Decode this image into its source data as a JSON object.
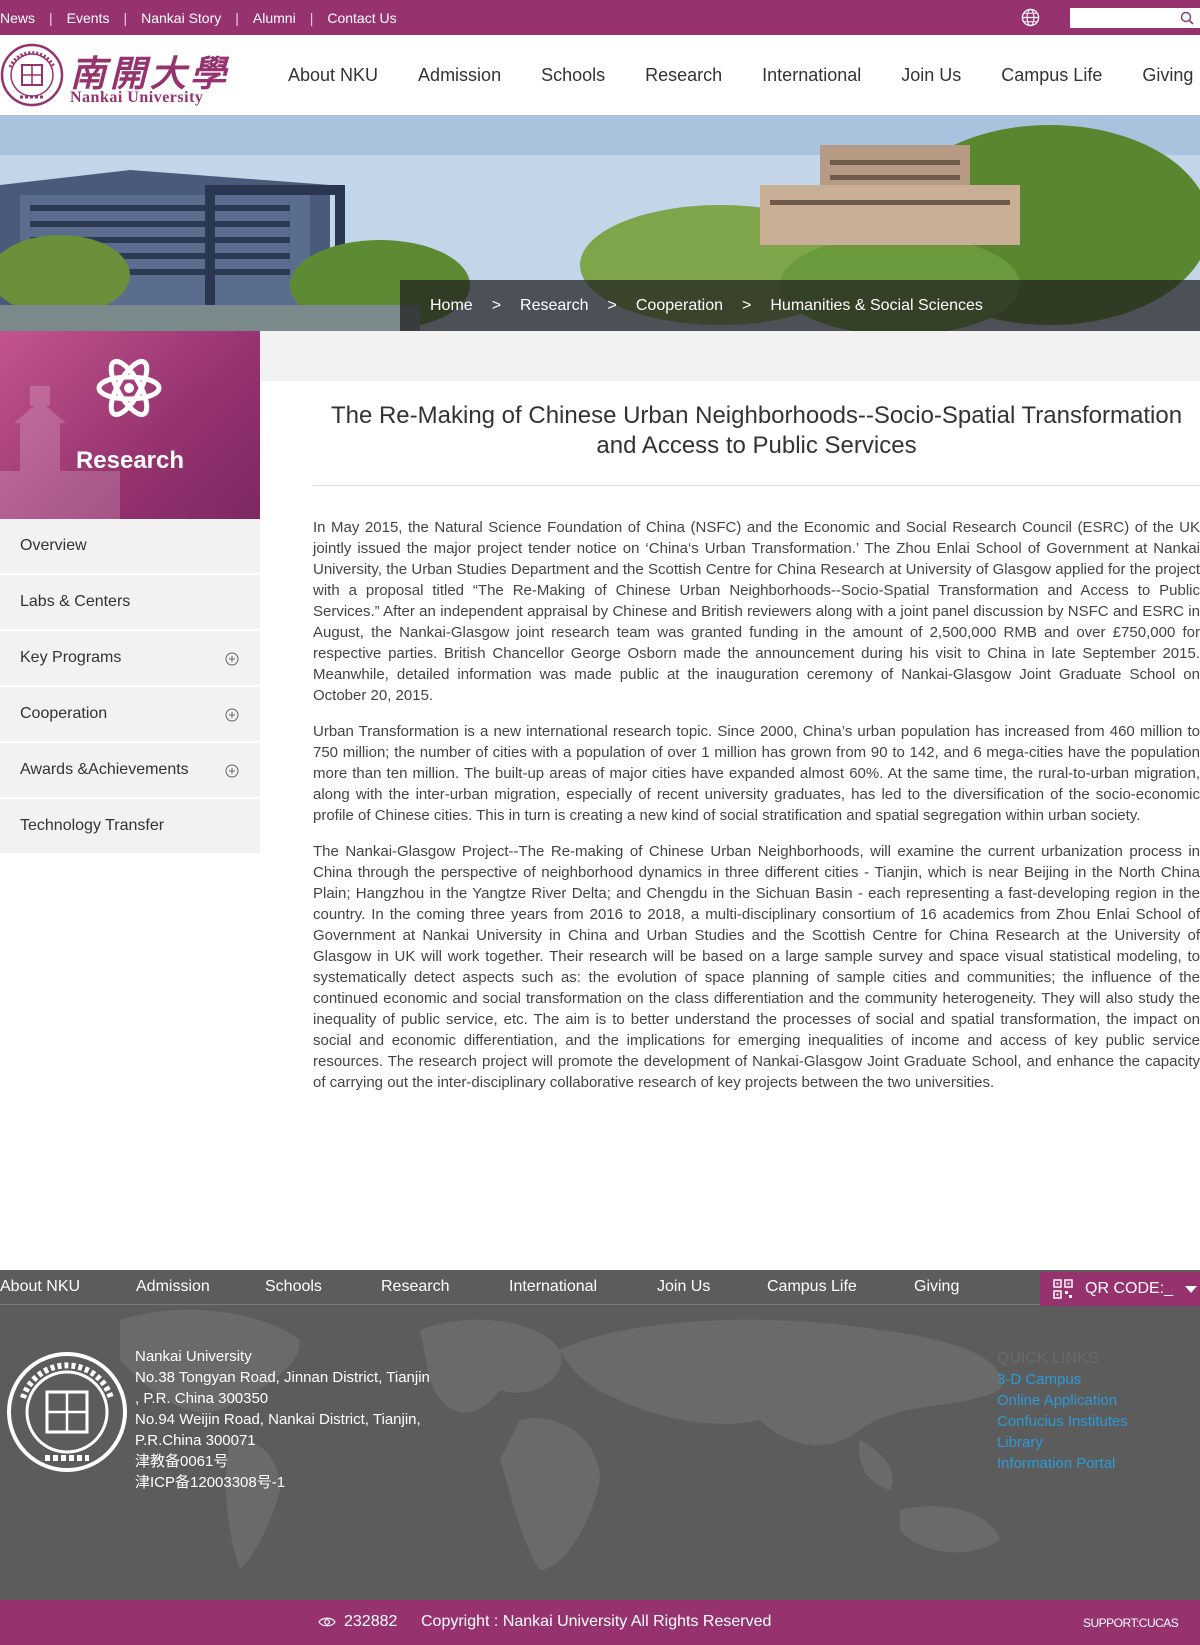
{
  "topbar": {
    "links": [
      "News",
      "Events",
      "Nankai Story",
      "Alumni",
      "Contact Us"
    ],
    "search_placeholder": ""
  },
  "header": {
    "logo_cn": "南開大學",
    "logo_en": "Nankai University",
    "nav": [
      "About NKU",
      "Admission",
      "Schools",
      "Research",
      "International",
      "Join Us",
      "Campus Life",
      "Giving"
    ]
  },
  "breadcrumb": {
    "items": [
      "Home",
      "Research",
      "Cooperation",
      "Humanities & Social Sciences"
    ],
    "separator": ">"
  },
  "sidebar": {
    "title": "Research",
    "items": [
      {
        "label": "Overview",
        "expandable": false
      },
      {
        "label": "Labs & Centers",
        "expandable": false
      },
      {
        "label": "Key Programs",
        "expandable": true
      },
      {
        "label": "Cooperation",
        "expandable": true
      },
      {
        "label": "Awards &Achievements",
        "expandable": true
      },
      {
        "label": "Technology Transfer",
        "expandable": false
      }
    ]
  },
  "article": {
    "title": "The Re-Making of Chinese Urban Neighborhoods--Socio-Spatial Transformation and Access to Public Services",
    "paragraphs": [
      "In May 2015, the Natural Science Foundation of China (NSFC) and the Economic and Social Research Council (ESRC) of the UK jointly issued the major project tender notice on ‘China‘s Urban Transformation.’ The Zhou Enlai School of Government at Nankai University, the Urban Studies Department and the Scottish Centre for China Research at University of Glasgow applied for the project with a proposal titled “The Re-Making of Chinese Urban Neighborhoods--Socio-Spatial Transformation and Access to Public Services.” After an independent appraisal by Chinese and British reviewers along with a joint panel discussion by NSFC and ESRC in August, the Nankai-Glasgow joint research team was granted funding in the amount of 2,500,000 RMB and over £750,000 for respective parties. British Chancellor George Osborn made the announcement during his visit to China in late September 2015. Meanwhile, detailed information was made public at the inauguration ceremony of Nankai-Glasgow Joint Graduate School on October 20, 2015.",
      "Urban Transformation is a new international research topic. Since 2000, China’s urban population has increased from 460 million to 750 million; the number of cities with a population of over 1 million has grown from 90 to 142, and 6 mega-cities have the population more than ten million. The built-up areas of major cities have expanded almost 60%. At the same time, the rural-to-urban migration, along with the inter-urban migration, especially of recent university graduates, has led to the diversification of the socio-economic profile of Chinese cities. This in turn is creating a new kind of social stratification and spatial segregation within urban society.",
      "The Nankai-Glasgow Project--The Re-making of Chinese Urban Neighborhoods, will examine the current urbanization process in China through the perspective of neighborhood dynamics in three different cities - Tianjin, which is near Beijing in the North China Plain; Hangzhou in the Yangtze River Delta; and Chengdu in the Sichuan Basin - each representing a fast-developing region in the country. In the coming three years from 2016 to 2018, a multi-disciplinary consortium of 16 academics from Zhou Enlai School of Government at Nankai University in China and Urban Studies and the Scottish Centre for China Research at the University of Glasgow in UK will work together. Their research will be based on a large sample survey and space visual statistical modeling, to systematically detect aspects such as: the evolution of space planning of sample cities and communities; the influence of the continued economic and social transformation on the class differentiation and the community heterogeneity. They will also study the inequality of public service, etc. The aim is to better understand the processes of social and spatial transformation, the impact on social and economic differentiation, and the implications for emerging inequalities of income and access of key public service resources. The research project will promote the development of Nankai-Glasgow Joint Graduate School, and enhance the capacity of carrying out the inter-disciplinary collaborative research of key projects between the two universities."
    ]
  },
  "footer": {
    "nav": [
      "About NKU",
      "Admission",
      "Schools",
      "Research",
      "International",
      "Join Us",
      "Campus Life",
      "Giving"
    ],
    "qr_label": "QR CODE:_",
    "address_lines": [
      "Nankai University",
      "No.38 Tongyan Road, Jinnan District, Tianjin",
      ", P.R. China 300350",
      "No.94 Weijin Road,  Nankai District, Tianjin,",
      "P.R.China  300071",
      "津教备0061号",
      "津ICP备12003308号-1"
    ],
    "quick_links_title": "QUICK LINKS",
    "quick_links": [
      "3-D Campus",
      "Online Application",
      "Confucius Institutes",
      "Library",
      "Information Portal"
    ]
  },
  "bottombar": {
    "view_count": "232882",
    "copyright": "Copyright : Nankai University All Rights Reserved",
    "support": "SUPPORT:CUCAS"
  },
  "colors": {
    "brand": "#96336f",
    "link": "#2a9bd8",
    "footer_bg": "#5c5c5c",
    "side_menu_bg": "#f2f2f2"
  },
  "icons": [
    "globe-icon",
    "search-icon",
    "atom-icon",
    "plus-circle-icon",
    "qr-code-icon",
    "eye-icon",
    "seal-logo"
  ]
}
